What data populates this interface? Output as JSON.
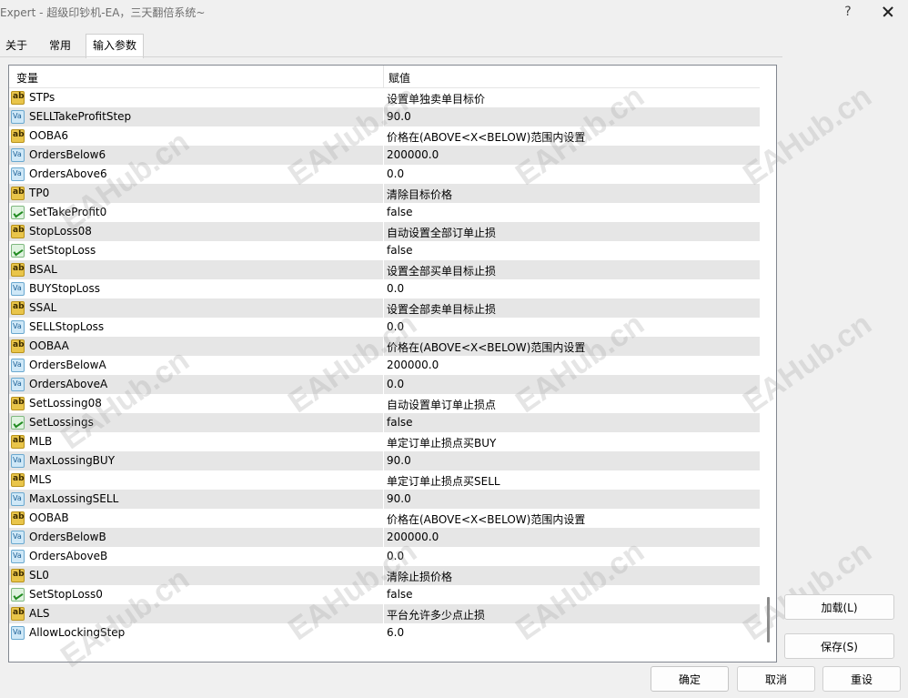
{
  "window": {
    "title": "Expert - 超级印钞机-EA，三天翻倍系统~",
    "help_label": "?",
    "close_icon": "close-icon"
  },
  "tabs": [
    {
      "label": "关于",
      "active": false
    },
    {
      "label": "常用",
      "active": false
    },
    {
      "label": "输入参数",
      "active": true
    }
  ],
  "grid": {
    "columns": {
      "variable": "变量",
      "value": "赋值"
    },
    "rows": [
      {
        "icon": "ab",
        "name": "STPs",
        "value": "设置单独卖单目标价"
      },
      {
        "icon": "va",
        "name": "SELLTakeProfitStep",
        "value": "90.0"
      },
      {
        "icon": "ab",
        "name": "OOBA6",
        "value": "价格在(ABOVE<X<BELOW)范围内设置"
      },
      {
        "icon": "va",
        "name": "OrdersBelow6",
        "value": "200000.0"
      },
      {
        "icon": "va",
        "name": "OrdersAbove6",
        "value": "0.0"
      },
      {
        "icon": "ab",
        "name": "TP0",
        "value": "清除目标价格"
      },
      {
        "icon": "bool",
        "name": "SetTakeProfit0",
        "value": "false"
      },
      {
        "icon": "ab",
        "name": "StopLoss08",
        "value": "自动设置全部订单止损"
      },
      {
        "icon": "bool",
        "name": "SetStopLoss",
        "value": "false"
      },
      {
        "icon": "ab",
        "name": "BSAL",
        "value": "设置全部买单目标止损"
      },
      {
        "icon": "va",
        "name": "BUYStopLoss",
        "value": "0.0"
      },
      {
        "icon": "ab",
        "name": "SSAL",
        "value": "设置全部卖单目标止损"
      },
      {
        "icon": "va",
        "name": "SELLStopLoss",
        "value": "0.0"
      },
      {
        "icon": "ab",
        "name": "OOBAA",
        "value": "价格在(ABOVE<X<BELOW)范围内设置"
      },
      {
        "icon": "va",
        "name": "OrdersBelowA",
        "value": "200000.0"
      },
      {
        "icon": "va",
        "name": "OrdersAboveA",
        "value": "0.0"
      },
      {
        "icon": "ab",
        "name": "SetLossing08",
        "value": "自动设置单订单止损点"
      },
      {
        "icon": "bool",
        "name": "SetLossings",
        "value": "false"
      },
      {
        "icon": "ab",
        "name": "MLB",
        "value": "单定订单止损点买BUY"
      },
      {
        "icon": "va",
        "name": "MaxLossingBUY",
        "value": "90.0"
      },
      {
        "icon": "ab",
        "name": "MLS",
        "value": "单定订单止损点买SELL"
      },
      {
        "icon": "va",
        "name": "MaxLossingSELL",
        "value": "90.0"
      },
      {
        "icon": "ab",
        "name": "OOBAB",
        "value": "价格在(ABOVE<X<BELOW)范围内设置"
      },
      {
        "icon": "va",
        "name": "OrdersBelowB",
        "value": "200000.0"
      },
      {
        "icon": "va",
        "name": "OrdersAboveB",
        "value": "0.0"
      },
      {
        "icon": "ab",
        "name": "SL0",
        "value": "清除止损价格"
      },
      {
        "icon": "bool",
        "name": "SetStopLoss0",
        "value": "false"
      },
      {
        "icon": "ab",
        "name": "ALS",
        "value": "平台允许多少点止损"
      },
      {
        "icon": "va",
        "name": "AllowLockingStep",
        "value": "6.0"
      }
    ]
  },
  "side_buttons": {
    "load": "加载(L)",
    "save": "保存(S)"
  },
  "bottom_buttons": {
    "ok": "确定",
    "cancel": "取消",
    "reset": "重设"
  },
  "watermark": "EAHub.cn"
}
